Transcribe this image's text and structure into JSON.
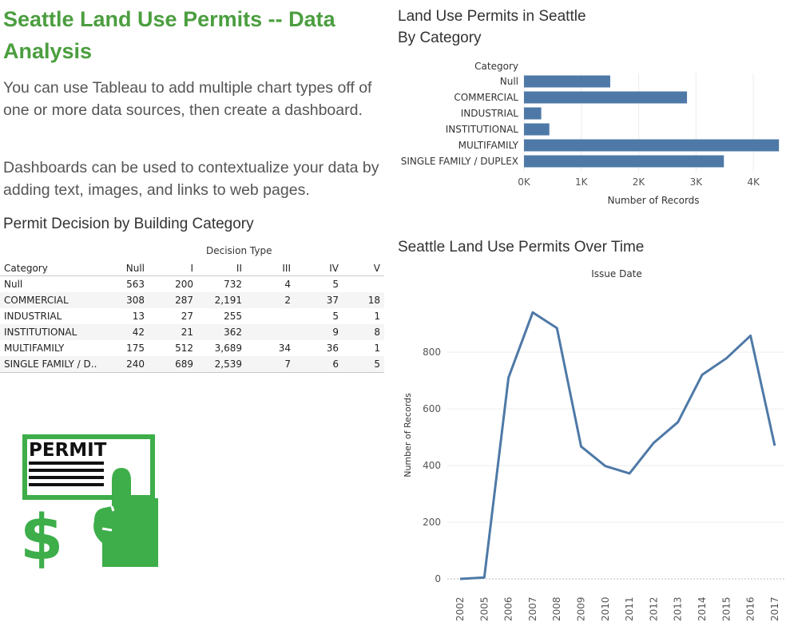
{
  "dashboard": {
    "title": "Seattle Land Use Permits -- Data Analysis",
    "paragraph1": "You can use Tableau to add multiple chart types off of one or more data sources, then create a dashboard.",
    "paragraph2": "Dashboards can be used to contextualize your data by adding text, images, and links to web pages.",
    "image_text": "PERMIT"
  },
  "crosstab": {
    "title": "Permit Decision by Building Category",
    "column_group": "Decision Type",
    "headers": [
      "Category",
      "Null",
      "I",
      "II",
      "III",
      "IV",
      "V"
    ],
    "rows": [
      [
        "Null",
        "563",
        "200",
        "732",
        "4",
        "5",
        ""
      ],
      [
        "COMMERCIAL",
        "308",
        "287",
        "2,191",
        "2",
        "37",
        "18"
      ],
      [
        "INDUSTRIAL",
        "13",
        "27",
        "255",
        "",
        "5",
        "1"
      ],
      [
        "INSTITUTIONAL",
        "42",
        "21",
        "362",
        "",
        "9",
        "8"
      ],
      [
        "MULTIFAMILY",
        "175",
        "512",
        "3,689",
        "34",
        "36",
        "1"
      ],
      [
        "SINGLE FAMILY / D..",
        "240",
        "689",
        "2,539",
        "7",
        "6",
        "5"
      ]
    ]
  },
  "chart_data": [
    {
      "type": "bar",
      "orientation": "horizontal",
      "title": "Land Use Permits in Seattle By Category",
      "title_lines": [
        "Land Use Permits in Seattle",
        "By Category"
      ],
      "category_header": "Category",
      "categories": [
        "Null",
        "COMMERCIAL",
        "INDUSTRIAL",
        "INSTITUTIONAL",
        "MULTIFAMILY",
        "SINGLE FAMILY / DUPLEX"
      ],
      "values": [
        1504,
        2843,
        301,
        442,
        4447,
        3486
      ],
      "xlabel": "Number of Records",
      "xlim": [
        0,
        4500
      ],
      "xticks": [
        0,
        1000,
        2000,
        3000,
        4000
      ],
      "xtick_labels": [
        "0K",
        "1K",
        "2K",
        "3K",
        "4K"
      ],
      "grid": true,
      "color": "#4e79a7"
    },
    {
      "type": "line",
      "title": "Seattle Land Use Permits Over Time",
      "header": "Issue Date",
      "x": [
        "2002",
        "2005",
        "2006",
        "2007",
        "2008",
        "2009",
        "2010",
        "2011",
        "2012",
        "2013",
        "2014",
        "2015",
        "2016",
        "2017"
      ],
      "y": [
        0,
        5,
        710,
        940,
        885,
        467,
        398,
        372,
        480,
        553,
        720,
        778,
        858,
        470
      ],
      "ylabel": "Number of Records",
      "ylim": [
        0,
        1000
      ],
      "yticks": [
        0,
        200,
        400,
        600,
        800
      ],
      "grid": true,
      "color": "#4e79a7"
    }
  ],
  "colors": {
    "title_green": "#4b9e3f",
    "icon_green": "#3dae49",
    "bar_blue": "#4e79a7"
  }
}
